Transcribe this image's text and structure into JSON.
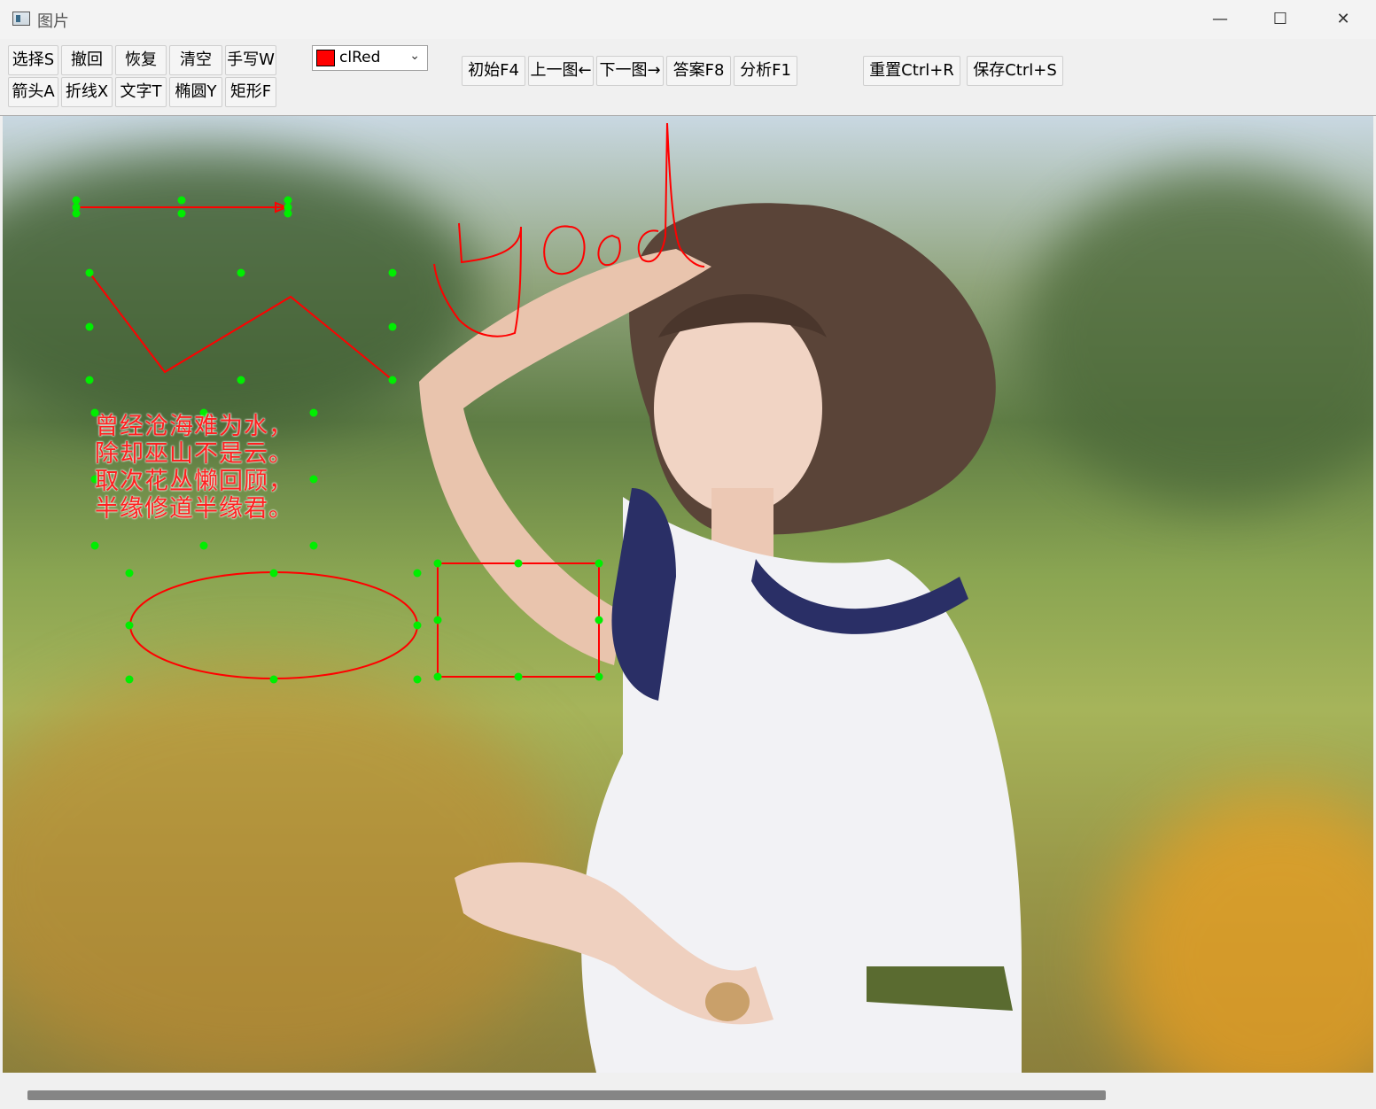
{
  "window": {
    "title": "图片",
    "minimize": "—",
    "maximize": "☐",
    "close": "✕"
  },
  "toolbar": {
    "tools_row1": [
      "选择S",
      "撤回",
      "恢复",
      "清空",
      "手写W"
    ],
    "tools_row2": [
      "箭头A",
      "折线X",
      "文字T",
      "椭圆Y",
      "矩形F"
    ],
    "color": {
      "value": "clRed",
      "swatch": "#ff0000"
    },
    "nav": [
      "初始F4",
      "上一图←",
      "下一图→",
      "答案F8",
      "分析F1"
    ],
    "reset": "重置Ctrl+R",
    "save": "保存Ctrl+S"
  },
  "canvas": {
    "handwriting": "good",
    "poem": [
      "曾经沧海难为水，",
      "除却巫山不是云。",
      "取次花丛懒回顾，",
      "半缘修道半缘君。"
    ],
    "annotation_color": "#ff0000",
    "handle_color": "#00ee00"
  }
}
